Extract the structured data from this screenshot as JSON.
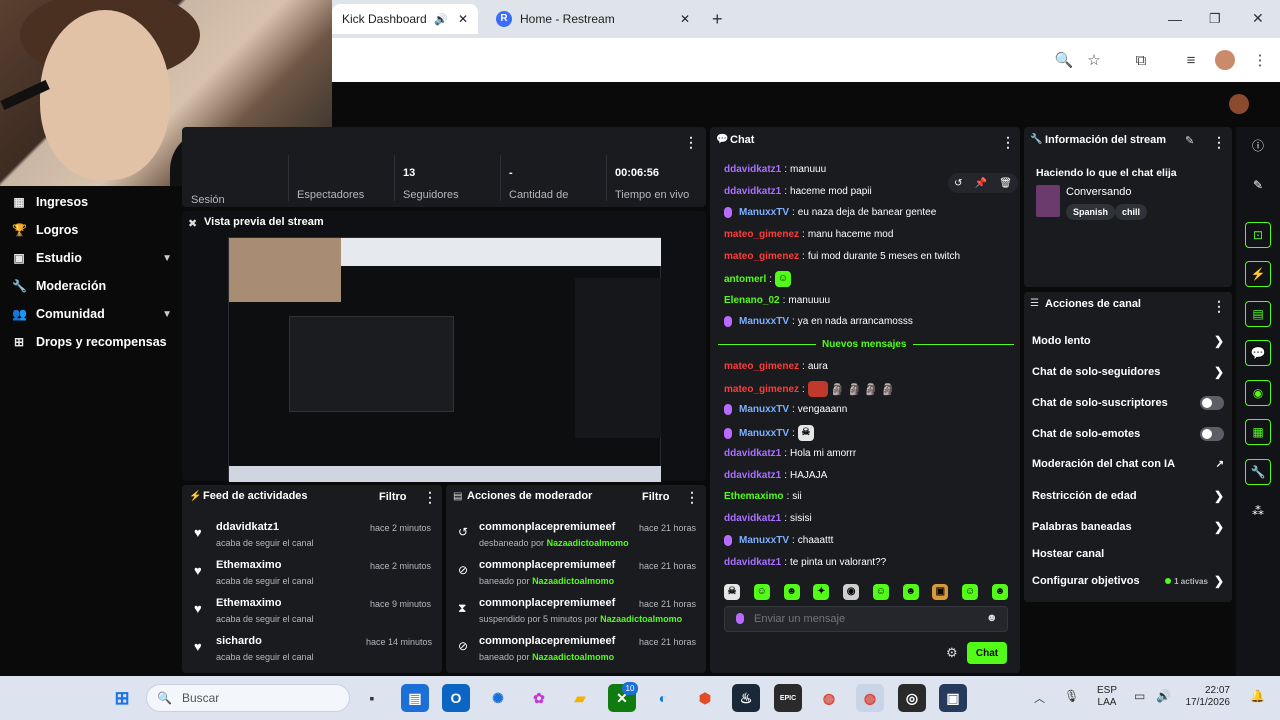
{
  "browser": {
    "tabs": [
      {
        "label": "Kick Dashboard"
      },
      {
        "label": "Home - Restream"
      }
    ],
    "new_tab": "+"
  },
  "sidebar": {
    "items": [
      {
        "label": "Ingresos"
      },
      {
        "label": "Logros"
      },
      {
        "label": "Estudio"
      },
      {
        "label": "Moderación"
      },
      {
        "label": "Comunidad"
      },
      {
        "label": "Drops y recompensas"
      }
    ]
  },
  "stats": {
    "session_label": "Sesión",
    "viewers_label": "Espectadores",
    "followers_value": "13",
    "followers_label": "Seguidores",
    "amount_value": "-",
    "amount_label": "Cantidad de",
    "live_value": "00:06:56",
    "live_label": "Tiempo en vivo"
  },
  "preview": {
    "title": "Vista previa del stream"
  },
  "activity_feed": {
    "title": "Feed de actividades",
    "filter": "Filtro",
    "items": [
      {
        "name": "ddavidkatz1",
        "action": "acaba de seguir el canal",
        "time": "hace 2 minutos"
      },
      {
        "name": "Ethemaximo",
        "action": "acaba de seguir el canal",
        "time": "hace 2 minutos"
      },
      {
        "name": "Ethemaximo",
        "action": "acaba de seguir el canal",
        "time": "hace 9 minutos"
      },
      {
        "name": "sichardo",
        "action": "acaba de seguir el canal",
        "time": "hace 14 minutos"
      }
    ]
  },
  "mod_actions": {
    "title": "Acciones de moderador",
    "filter": "Filtro",
    "items": [
      {
        "name": "commonplacepremiumeef",
        "action": "desbaneado por",
        "by": "Nazaadictoalmomo",
        "time": "hace 21 horas"
      },
      {
        "name": "commonplacepremiumeef",
        "action": "baneado por",
        "by": "Nazaadictoalmomo",
        "time": "hace 21 horas"
      },
      {
        "name": "commonplacepremiumeef",
        "action": "suspendido por 5 minutos por",
        "by": "Nazaadictoalmomo",
        "time": "hace 21 horas"
      },
      {
        "name": "commonplacepremiumeef",
        "action": "baneado por",
        "by": "Nazaadictoalmomo",
        "time": "hace 21 horas"
      }
    ]
  },
  "chat": {
    "title": "Chat",
    "new_messages": "Nuevos mensajes",
    "input_placeholder": "Enviar un mensaje",
    "send_label": "Chat",
    "messages": [
      {
        "user": "ddavidkatz1",
        "text": "manuuu"
      },
      {
        "user": "ddavidkatz1",
        "text": "haceme mod papii"
      },
      {
        "user": "ManuxxTV",
        "text": "eu naza deja de banear gentee"
      },
      {
        "user": "mateo_gimenez",
        "text": "manu haceme mod"
      },
      {
        "user": "mateo_gimenez",
        "text": "fui mod durante 5 meses en twitch"
      },
      {
        "user": "antomerl",
        "text": ""
      },
      {
        "user": "Elenano_02",
        "text": "manuuuu"
      },
      {
        "user": "ManuxxTV",
        "text": "ya en nada arrancamosss"
      },
      {
        "user": "mateo_gimenez",
        "text": "aura"
      },
      {
        "user": "mateo_gimenez",
        "text": ""
      },
      {
        "user": "ManuxxTV",
        "text": "vengaaann"
      },
      {
        "user": "ManuxxTV",
        "text": ""
      },
      {
        "user": "ddavidkatz1",
        "text": "Hola mi amorrr"
      },
      {
        "user": "ddavidkatz1",
        "text": "HAJAJA"
      },
      {
        "user": "Ethemaximo",
        "text": "sii"
      },
      {
        "user": "ddavidkatz1",
        "text": "sisisi"
      },
      {
        "user": "ManuxxTV",
        "text": "chaaattt"
      },
      {
        "user": "ddavidkatz1",
        "text": "te pinta un valorant??"
      }
    ]
  },
  "stream_info": {
    "title": "Información del stream",
    "stream_title": "Haciendo lo que el chat elija",
    "category": "Conversando",
    "tags": [
      "Spanish",
      "chill"
    ]
  },
  "channel_actions": {
    "title": "Acciones de canal",
    "items": [
      {
        "label": "Modo lento"
      },
      {
        "label": "Chat de solo-seguidores"
      },
      {
        "label": "Chat de solo-suscriptores"
      },
      {
        "label": "Chat de solo-emotes"
      },
      {
        "label": "Moderación del chat con IA"
      },
      {
        "label": "Restricción de edad"
      },
      {
        "label": "Palabras baneadas"
      },
      {
        "label": "Hostear canal"
      },
      {
        "label": "Configurar objetivos"
      }
    ],
    "goals_badge": "1 activas"
  },
  "taskbar": {
    "search_placeholder": "Buscar",
    "lang": "ESP",
    "lang2": "LAA",
    "time": "22:07",
    "date": "17/1/2026",
    "badge": "10",
    "epic_label": "EPIC"
  },
  "colors": {
    "accent": "#53fc18",
    "panel": "#191b1f",
    "bg": "#0a0a0a"
  }
}
